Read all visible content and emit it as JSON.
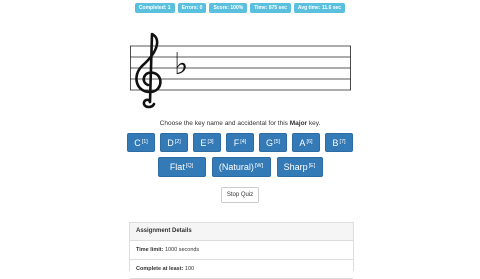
{
  "stats": {
    "completed": "Completed: 1",
    "errors": "Errors: 0",
    "score": "Score: 100%",
    "time": "Time: 875 sec",
    "avg_time": "Avg time: 11.6 sec"
  },
  "staff": {
    "clef": "treble-clef",
    "accidental": "♭"
  },
  "prompt": {
    "before": "Choose the key name and accidental for this ",
    "key_type": "Major",
    "after": " key."
  },
  "note_buttons": [
    {
      "label": "C",
      "shortcut": "[1]"
    },
    {
      "label": "D",
      "shortcut": "[2]"
    },
    {
      "label": "E",
      "shortcut": "[3]"
    },
    {
      "label": "F",
      "shortcut": "[4]"
    },
    {
      "label": "G",
      "shortcut": "[5]"
    },
    {
      "label": "A",
      "shortcut": "[6]"
    },
    {
      "label": "B",
      "shortcut": "[7]"
    }
  ],
  "accidental_buttons": [
    {
      "label": "Flat",
      "shortcut": "[Q]"
    },
    {
      "label": "(Natural)",
      "shortcut": "[W]"
    },
    {
      "label": "Sharp",
      "shortcut": "[E]"
    }
  ],
  "stop_button": "Stop Quiz",
  "assignment": {
    "title": "Assignment Details",
    "time_limit_label": "Time limit:",
    "time_limit_value": "1000 seconds",
    "complete_label": "Complete at least:",
    "complete_value": "100"
  },
  "colors": {
    "stat_badge": "#5bc0de",
    "primary_button": "#337ab7"
  }
}
